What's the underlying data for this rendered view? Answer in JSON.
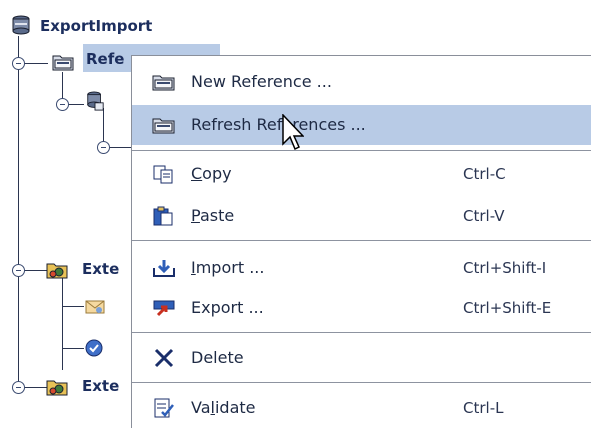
{
  "tree": {
    "root": {
      "label": "ExportImport",
      "icon": "database-icon"
    },
    "items": [
      {
        "label": "Refe",
        "icon": "folder-icon",
        "selected": true
      },
      {
        "label": "Exte",
        "icon": "extension-folder-icon"
      },
      {
        "label": "Exte",
        "icon": "extension-folder-icon"
      }
    ]
  },
  "menu": {
    "items": [
      {
        "label": "New Reference ...",
        "shortcut": "",
        "icon": "folder-icon"
      },
      {
        "label": "Refresh References ...",
        "shortcut": "",
        "icon": "folder-refresh-icon",
        "hover": true
      },
      {
        "label": "Copy",
        "mnemonic": "C",
        "rest": "opy",
        "shortcut": "Ctrl-C",
        "icon": "copy-icon"
      },
      {
        "label": "Paste",
        "mnemonic": "P",
        "rest": "aste",
        "shortcut": "Ctrl-V",
        "icon": "paste-icon"
      },
      {
        "label": "Import ...",
        "mnemonic": "I",
        "rest": "mport ...",
        "shortcut": "Ctrl+Shift-I",
        "icon": "import-icon"
      },
      {
        "label": "Export ...",
        "shortcut": "Ctrl+Shift-E",
        "icon": "export-icon"
      },
      {
        "label": "Delete",
        "shortcut": "",
        "icon": "delete-icon"
      },
      {
        "label": "Validate",
        "pre": "Va",
        "mnemonic": "l",
        "rest": "idate",
        "shortcut": "Ctrl-L",
        "icon": "validate-icon"
      }
    ]
  },
  "colors": {
    "highlight": "#b8cbe6",
    "text": "#1e2a44",
    "tree_text": "#1c2e5e"
  }
}
